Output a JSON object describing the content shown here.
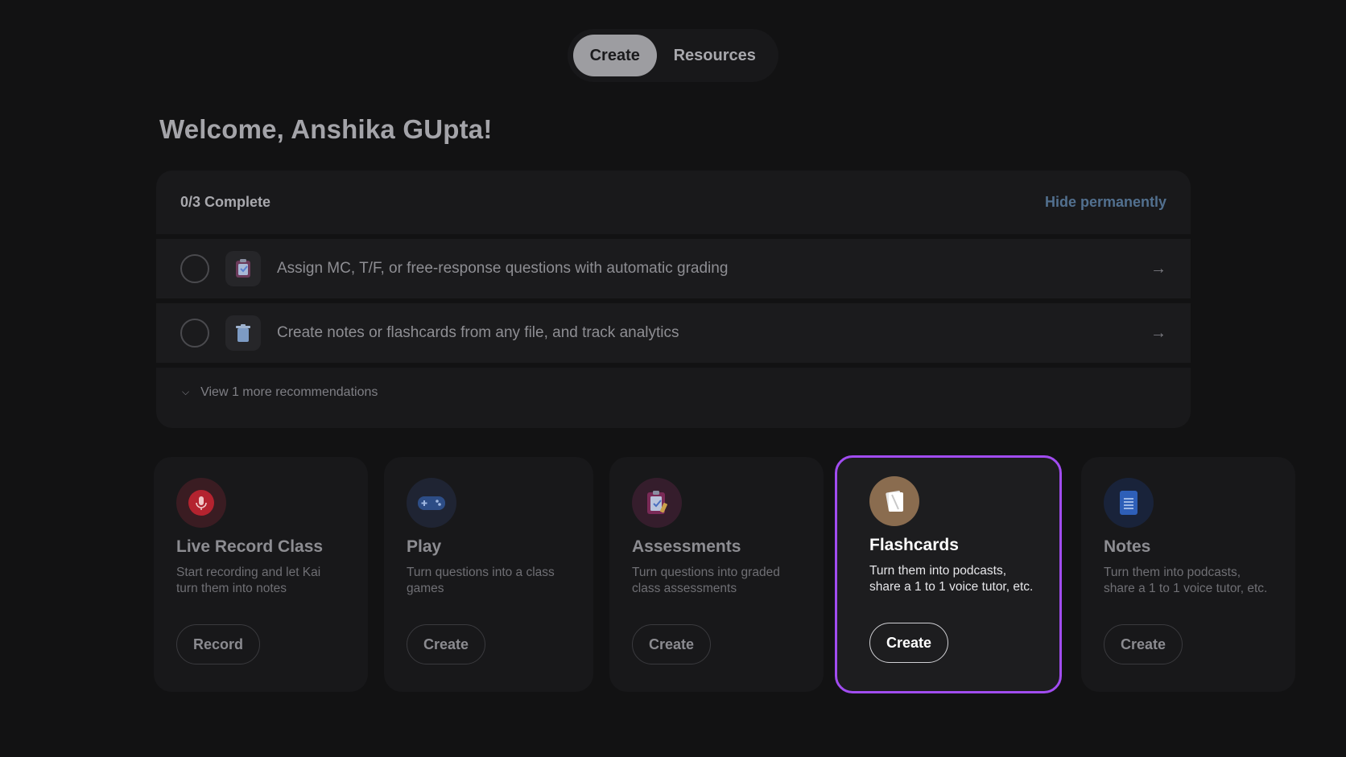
{
  "tabs": [
    {
      "label": "Create",
      "active": true
    },
    {
      "label": "Resources",
      "active": false
    }
  ],
  "welcome": "Welcome, Anshika GUpta!",
  "checklist": {
    "progress": "0/3 Complete",
    "hide_label": "Hide permanently",
    "items": [
      {
        "text": "Assign MC, T/F, or free-response questions with automatic grading",
        "icon": "assessment-icon",
        "done": false
      },
      {
        "text": "Create notes or flashcards from any file, and track analytics",
        "icon": "trash-icon",
        "done": false
      }
    ],
    "more_label": "View 1 more recommendations"
  },
  "cards": [
    {
      "title": "Live Record Class",
      "desc": "Start recording and let Kai turn them into notes",
      "button": "Record",
      "icon": "microphone-icon",
      "color": "#b4232f"
    },
    {
      "title": "Play",
      "desc": "Turn questions into a class games",
      "button": "Create",
      "icon": "gamepad-icon",
      "color": "#2d4d86"
    },
    {
      "title": "Assessments",
      "desc": "Turn questions into graded class assessments",
      "button": "Create",
      "icon": "clipboard-icon",
      "color": "#7a2a57"
    },
    {
      "title": "Flashcards",
      "desc": "Turn them into podcasts, share a 1 to 1 voice tutor, etc.",
      "button": "Create",
      "icon": "flashcard-icon",
      "color": "#8a6c4f"
    },
    {
      "title": "Notes",
      "desc": "Turn them into podcasts, share a 1 to 1 voice tutor, etc.",
      "button": "Create",
      "icon": "note-icon",
      "color": "#2e5fb8"
    }
  ],
  "accent": "#a14cf0"
}
